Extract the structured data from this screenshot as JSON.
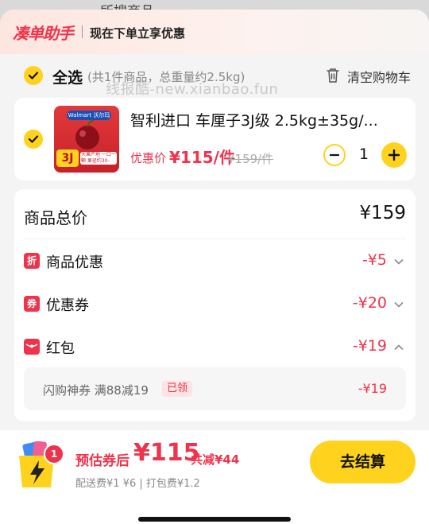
{
  "backdrop": {
    "text": "所搜商品"
  },
  "header": {
    "brand": "凑单助手",
    "subtitle": "现在下单立享优惠"
  },
  "selection": {
    "label": "全选",
    "info": "(共1件商品，总重量约2.5kg)",
    "clear_label": "清空购物车",
    "watermark": "线报酷-new.xianbao.fun"
  },
  "item": {
    "title": "智利进口 车厘子3J级 2.5kg±35g/...",
    "price_label": "优惠价",
    "price": "¥115/件",
    "original_price": "¥159/件",
    "quantity": "1",
    "image": {
      "tag": "Walmart 沃尔玛",
      "grade": "3J",
      "band": "大果产地 一口一颗 果径约30-31.9mm"
    }
  },
  "summary": {
    "title": "商品总价",
    "total": "¥159",
    "rows": [
      {
        "icon": "折",
        "label": "商品优惠",
        "value": "-¥5"
      },
      {
        "icon": "券",
        "label": "优惠券",
        "value": "-¥20"
      },
      {
        "icon": "",
        "label": "红包",
        "value": "-¥19"
      }
    ],
    "coupon": {
      "name": "闪购神券  满88减19",
      "badge": "已领",
      "value": "-¥19"
    }
  },
  "footer": {
    "bag_count": "1",
    "est_label": "预估券后",
    "est_value": "¥115",
    "saved": "共减¥44",
    "fees": "配送费¥1 ¥6 | 打包费¥1.2",
    "checkout": "去结算"
  },
  "colors": {
    "accent": "#ffd21e",
    "price_red": "#f0324a"
  }
}
